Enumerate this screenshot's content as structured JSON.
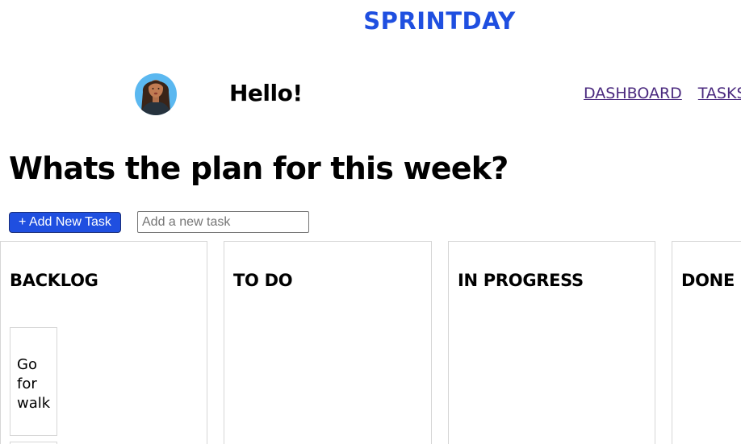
{
  "app": {
    "brand": "SPRINTDAY"
  },
  "header": {
    "greeting": "Hello!",
    "nav": [
      {
        "label": "DASHBOARD"
      },
      {
        "label": "TASKS"
      }
    ]
  },
  "main": {
    "headline": "Whats the plan for this week?",
    "add_button_label": "+ Add New Task",
    "task_input": {
      "placeholder": "Add a new task",
      "value": ""
    },
    "columns": [
      {
        "title": "BACKLOG",
        "cards": [
          {
            "text": "Go for walk"
          }
        ]
      },
      {
        "title": "TO DO",
        "cards": []
      },
      {
        "title": "IN PROGRESS",
        "cards": []
      },
      {
        "title": "DONE",
        "cards": []
      }
    ]
  },
  "colors": {
    "brand": "#1f4fe0",
    "nav_link": "#4b2a7f",
    "avatar_bg": "#5bb8f0"
  }
}
